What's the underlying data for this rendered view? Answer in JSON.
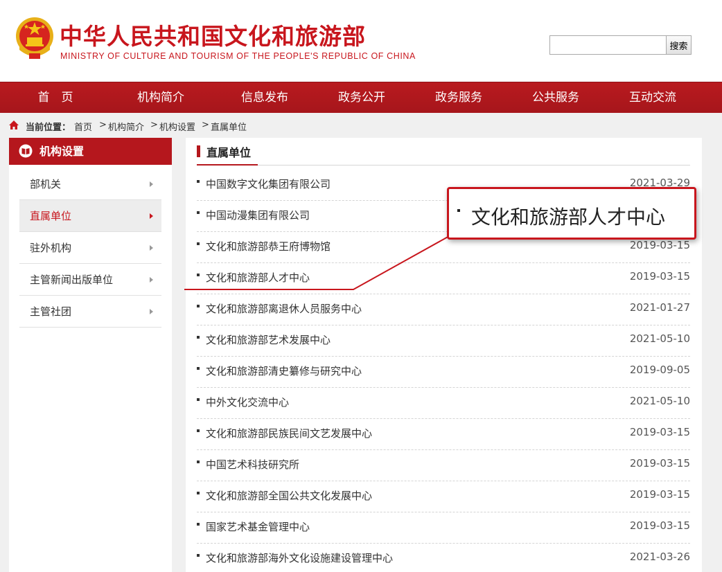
{
  "header": {
    "title": "中华人民共和国文化和旅游部",
    "subtitle": "MINISTRY OF CULTURE AND TOURISM OF THE PEOPLE'S REPUBLIC OF CHINA",
    "search_placeholder": "",
    "search_button": "搜索",
    "emblem_icon": "national-emblem-icon"
  },
  "nav": {
    "items": [
      {
        "label": "首　页"
      },
      {
        "label": "机构简介"
      },
      {
        "label": "信息发布"
      },
      {
        "label": "政务公开"
      },
      {
        "label": "政务服务"
      },
      {
        "label": "公共服务"
      },
      {
        "label": "互动交流"
      }
    ]
  },
  "breadcrumb": {
    "label": "当前位置：",
    "items": [
      "首页",
      "机构简介",
      "机构设置",
      "直属单位"
    ],
    "separator": ">"
  },
  "sidebar": {
    "title": "机构设置",
    "items": [
      {
        "label": "部机关",
        "active": false
      },
      {
        "label": "直属单位",
        "active": true
      },
      {
        "label": "驻外机构",
        "active": false
      },
      {
        "label": "主管新闻出版单位",
        "active": false
      },
      {
        "label": "主管社团",
        "active": false
      }
    ]
  },
  "main": {
    "title": "直属单位",
    "rows": [
      {
        "name": "中国数字文化集团有限公司",
        "date": "2021-03-29"
      },
      {
        "name": "中国动漫集团有限公司",
        "date": ""
      },
      {
        "name": "文化和旅游部恭王府博物馆",
        "date": "2019-03-15"
      },
      {
        "name": "文化和旅游部人才中心",
        "date": "2019-03-15"
      },
      {
        "name": "文化和旅游部离退休人员服务中心",
        "date": "2021-01-27"
      },
      {
        "name": "文化和旅游部艺术发展中心",
        "date": "2021-05-10"
      },
      {
        "name": "文化和旅游部清史纂修与研究中心",
        "date": "2019-09-05"
      },
      {
        "name": "中外文化交流中心",
        "date": "2021-05-10"
      },
      {
        "name": "文化和旅游部民族民间文艺发展中心",
        "date": "2019-03-15"
      },
      {
        "name": "中国艺术科技研究所",
        "date": "2019-03-15"
      },
      {
        "name": "文化和旅游部全国公共文化发展中心",
        "date": "2019-03-15"
      },
      {
        "name": "国家艺术基金管理中心",
        "date": "2019-03-15"
      },
      {
        "name": "文化和旅游部海外文化设施建设管理中心",
        "date": "2021-03-26"
      }
    ]
  },
  "callout": {
    "text": "文化和旅游部人才中心"
  },
  "colors": {
    "brand_red": "#c8161d",
    "nav_red": "#b91a1f"
  }
}
